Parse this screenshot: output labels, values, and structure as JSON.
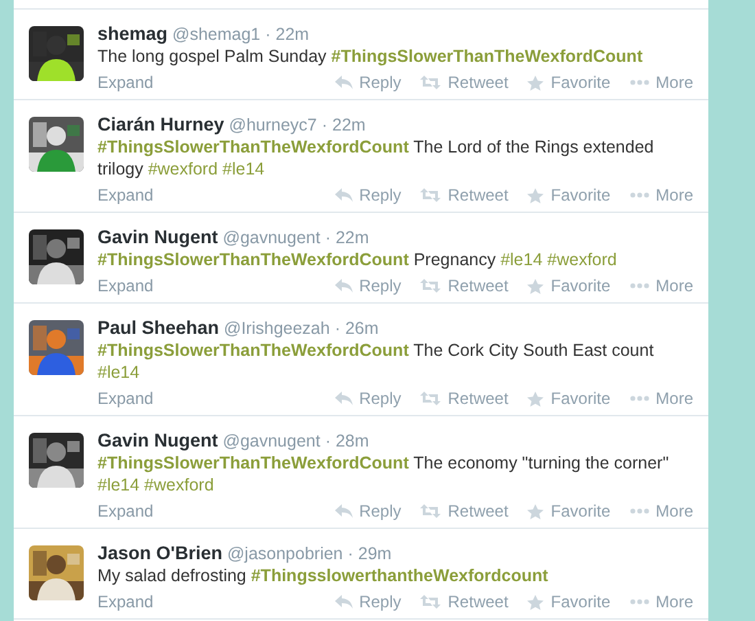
{
  "tweets": [
    {
      "name": "shemag",
      "handle": "@shemag1",
      "time": "· 22m",
      "avatar": {
        "kind": "picture"
      },
      "body": [
        {
          "kind": "text",
          "text": "The long gospel Palm Sunday "
        },
        {
          "kind": "hashtag",
          "text": "#ThingsSlowerThanTheWexfordCount",
          "bold": true
        }
      ],
      "expand": "Expand",
      "actions": [
        "Reply",
        "Retweet",
        "Favorite",
        "More"
      ]
    },
    {
      "name": "Ciarán Hurney",
      "handle": "@hurneyc7",
      "time": "· 22m",
      "avatar": {
        "kind": "picture"
      },
      "body": [
        {
          "kind": "hashtag",
          "text": "#ThingsSlowerThanTheWexfordCount",
          "bold": true
        },
        {
          "kind": "text",
          "text": " The Lord of the Rings extended trilogy "
        },
        {
          "kind": "hashtag",
          "text": "#wexford #le14",
          "bold": false
        }
      ],
      "expand": "Expand",
      "actions": [
        "Reply",
        "Retweet",
        "Favorite",
        "More"
      ]
    },
    {
      "name": "Gavin Nugent",
      "handle": "@gavnugent",
      "time": "· 22m",
      "avatar": {
        "kind": "picture"
      },
      "body": [
        {
          "kind": "hashtag",
          "text": "#ThingsSlowerThanTheWexfordCount",
          "bold": true
        },
        {
          "kind": "text",
          "text": " Pregnancy "
        },
        {
          "kind": "hashtag",
          "text": "#le14 #wexford",
          "bold": false
        }
      ],
      "expand": "Expand",
      "actions": [
        "Reply",
        "Retweet",
        "Favorite",
        "More"
      ]
    },
    {
      "name": "Paul Sheehan",
      "handle": "@Irishgeezah",
      "time": "· 26m",
      "avatar": {
        "kind": "picture"
      },
      "body": [
        {
          "kind": "hashtag",
          "text": "#ThingsSlowerThanTheWexfordCount",
          "bold": true
        },
        {
          "kind": "text",
          "text": " The Cork City South East count "
        },
        {
          "kind": "hashtag",
          "text": "#le14",
          "bold": false
        }
      ],
      "expand": "Expand",
      "actions": [
        "Reply",
        "Retweet",
        "Favorite",
        "More"
      ]
    },
    {
      "name": "Gavin Nugent",
      "handle": "@gavnugent",
      "time": "· 28m",
      "avatar": {
        "kind": "picture"
      },
      "body": [
        {
          "kind": "hashtag",
          "text": "#ThingsSlowerThanTheWexfordCount",
          "bold": true
        },
        {
          "kind": "text",
          "text": " The economy \"turning the corner\" "
        },
        {
          "kind": "hashtag",
          "text": "#le14 #wexford",
          "bold": false
        }
      ],
      "expand": "Expand",
      "actions": [
        "Reply",
        "Retweet",
        "Favorite",
        "More"
      ]
    },
    {
      "name": "Jason O'Brien",
      "handle": "@jasonpobrien",
      "time": "· 29m",
      "avatar": {
        "kind": "picture"
      },
      "body": [
        {
          "kind": "text",
          "text": "My salad defrosting "
        },
        {
          "kind": "hashtag",
          "text": "#ThingsslowerthantheWexfordcount",
          "bold": true
        }
      ],
      "expand": "Expand",
      "actions": [
        "Reply",
        "Retweet",
        "Favorite",
        "More"
      ]
    }
  ]
}
